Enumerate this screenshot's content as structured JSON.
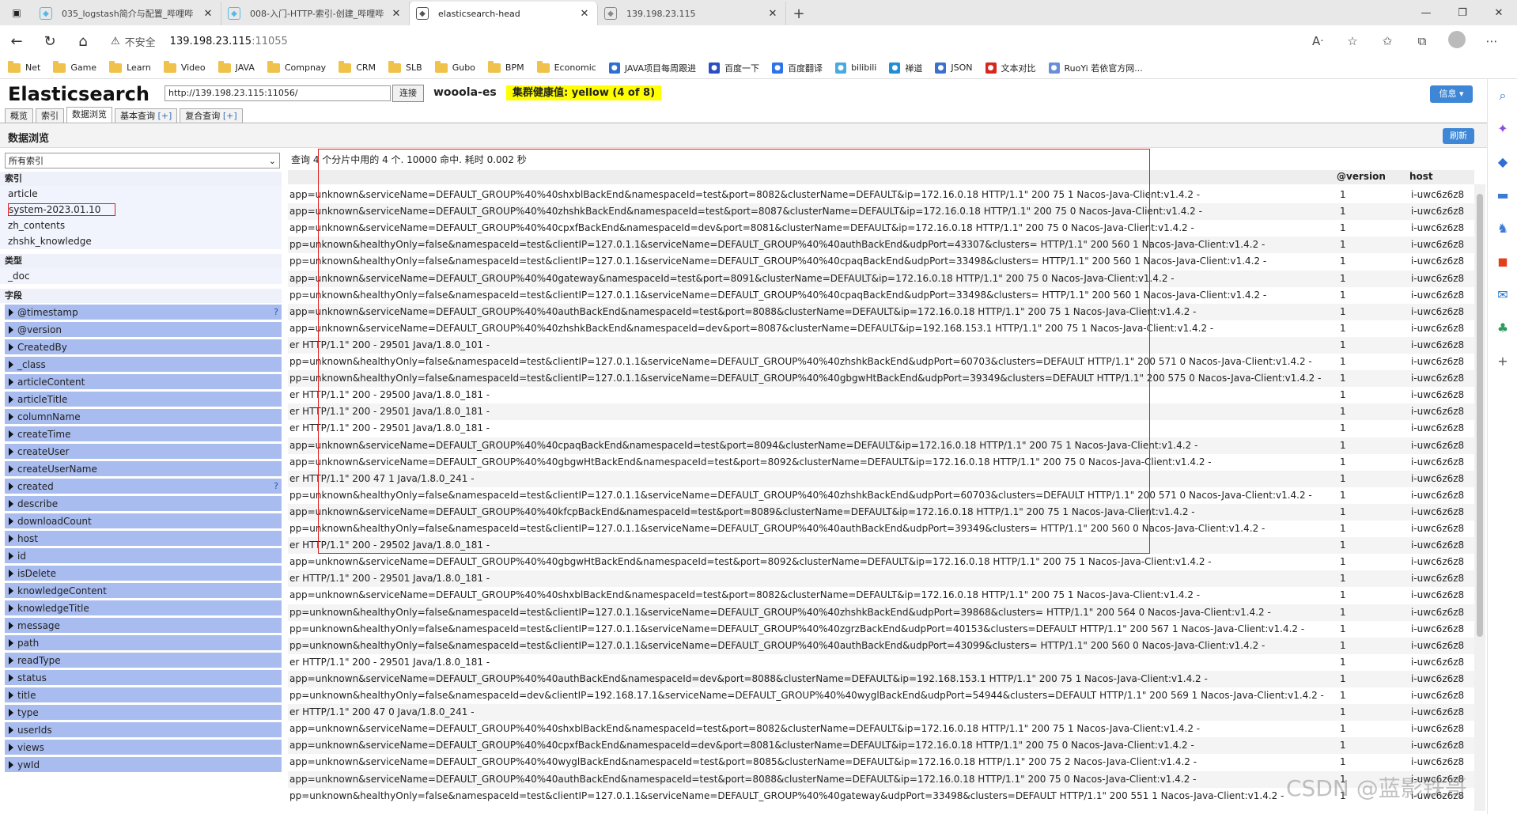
{
  "browser": {
    "tabs": [
      {
        "title": "035_logstash简介与配置_哔哩哔",
        "fav_color": "#59b8e6",
        "active": false
      },
      {
        "title": "008-入门-HTTP-索引-创建_哔哩哔",
        "fav_color": "#59b8e6",
        "active": false
      },
      {
        "title": "elasticsearch-head",
        "fav_color": "#555555",
        "active": true
      },
      {
        "title": "139.198.23.115",
        "fav_color": "#888888",
        "active": false
      }
    ],
    "address": {
      "insecure_label": "不安全",
      "host": "139.198.23.115",
      "port": ":11055"
    },
    "bookmarks": [
      {
        "label": "Net",
        "type": "folder"
      },
      {
        "label": "Game",
        "type": "folder"
      },
      {
        "label": "Learn",
        "type": "folder"
      },
      {
        "label": "Video",
        "type": "folder"
      },
      {
        "label": "JAVA",
        "type": "folder"
      },
      {
        "label": "Compnay",
        "type": "folder"
      },
      {
        "label": "CRM",
        "type": "folder"
      },
      {
        "label": "SLB",
        "type": "folder"
      },
      {
        "label": "Gubo",
        "type": "folder"
      },
      {
        "label": "BPM",
        "type": "folder"
      },
      {
        "label": "Economic",
        "type": "folder"
      },
      {
        "label": "JAVA项目每周跟进",
        "type": "icon",
        "color": "#2f6fd1"
      },
      {
        "label": "百度一下",
        "type": "icon",
        "color": "#2b4fbf"
      },
      {
        "label": "百度翻译",
        "type": "icon",
        "color": "#2e73e8"
      },
      {
        "label": "bilibili",
        "type": "icon",
        "color": "#49a9e0"
      },
      {
        "label": "禅道",
        "type": "icon",
        "color": "#1f8fd8"
      },
      {
        "label": "JSON",
        "type": "icon",
        "color": "#3b6fd1"
      },
      {
        "label": "文本对比",
        "type": "icon",
        "color": "#d7261e"
      },
      {
        "label": "RuoYi 若依官方网...",
        "type": "icon",
        "color": "#6a8fd8"
      }
    ]
  },
  "app": {
    "logo": "Elasticsearch",
    "cluster_url": "http://139.198.23.115:11056/",
    "connect_label": "连接",
    "cluster_name": "wooola-es",
    "health": "集群健康值: yellow (4 of 8)",
    "info_label": "信息 ▾",
    "tabs": [
      {
        "label": "概览",
        "plus": ""
      },
      {
        "label": "索引",
        "plus": ""
      },
      {
        "label": "数据浏览",
        "plus": ""
      },
      {
        "label": "基本查询 ",
        "plus": "[+]"
      },
      {
        "label": "复合查询 ",
        "plus": "[+]"
      }
    ],
    "section_title": "数据浏览",
    "refresh_label": "刷新"
  },
  "left": {
    "select_value": "所有索引",
    "index_header": "索引",
    "indices": [
      "article",
      "system-2023.01.10",
      "zh_contents",
      "zhshk_knowledge"
    ],
    "type_header": "类型",
    "types": [
      "_doc"
    ],
    "field_header": "字段",
    "fields": [
      {
        "name": "@timestamp",
        "q": "?"
      },
      {
        "name": "@version",
        "q": ""
      },
      {
        "name": "CreatedBy",
        "q": ""
      },
      {
        "name": "_class",
        "q": ""
      },
      {
        "name": "articleContent",
        "q": ""
      },
      {
        "name": "articleTitle",
        "q": ""
      },
      {
        "name": "columnName",
        "q": ""
      },
      {
        "name": "createTime",
        "q": ""
      },
      {
        "name": "createUser",
        "q": ""
      },
      {
        "name": "createUserName",
        "q": ""
      },
      {
        "name": "created",
        "q": "?"
      },
      {
        "name": "describe",
        "q": ""
      },
      {
        "name": "downloadCount",
        "q": ""
      },
      {
        "name": "host",
        "q": ""
      },
      {
        "name": "id",
        "q": ""
      },
      {
        "name": "isDelete",
        "q": ""
      },
      {
        "name": "knowledgeContent",
        "q": ""
      },
      {
        "name": "knowledgeTitle",
        "q": ""
      },
      {
        "name": "message",
        "q": ""
      },
      {
        "name": "path",
        "q": ""
      },
      {
        "name": "readType",
        "q": ""
      },
      {
        "name": "status",
        "q": ""
      },
      {
        "name": "title",
        "q": ""
      },
      {
        "name": "type",
        "q": ""
      },
      {
        "name": "userIds",
        "q": ""
      },
      {
        "name": "views",
        "q": ""
      },
      {
        "name": "ywId",
        "q": ""
      }
    ]
  },
  "results": {
    "meta": "查询 4 个分片中用的 4 个. 10000 命中. 耗时 0.002 秒",
    "columns": [
      "@version",
      "host"
    ],
    "rows": [
      {
        "msg": "app=unknown&serviceName=DEFAULT_GROUP%40%40shxblBackEnd&namespaceId=test&port=8082&clusterName=DEFAULT&ip=172.16.0.18 HTTP/1.1\" 200 75 1 Nacos-Java-Client:v1.4.2 -",
        "ver": "1",
        "host": "i-uwc6z6z8"
      },
      {
        "msg": "app=unknown&serviceName=DEFAULT_GROUP%40%40zhshkBackEnd&namespaceId=test&port=8087&clusterName=DEFAULT&ip=172.16.0.18 HTTP/1.1\" 200 75 0 Nacos-Java-Client:v1.4.2 -",
        "ver": "1",
        "host": "i-uwc6z6z8"
      },
      {
        "msg": "app=unknown&serviceName=DEFAULT_GROUP%40%40cpxfBackEnd&namespaceId=dev&port=8081&clusterName=DEFAULT&ip=172.16.0.18 HTTP/1.1\" 200 75 0 Nacos-Java-Client:v1.4.2 -",
        "ver": "1",
        "host": "i-uwc6z6z8"
      },
      {
        "msg": "pp=unknown&healthyOnly=false&namespaceId=test&clientIP=127.0.1.1&serviceName=DEFAULT_GROUP%40%40authBackEnd&udpPort=43307&clusters= HTTP/1.1\" 200 560 1 Nacos-Java-Client:v1.4.2 -",
        "ver": "1",
        "host": "i-uwc6z6z8"
      },
      {
        "msg": "pp=unknown&healthyOnly=false&namespaceId=test&clientIP=127.0.1.1&serviceName=DEFAULT_GROUP%40%40cpaqBackEnd&udpPort=33498&clusters= HTTP/1.1\" 200 560 1 Nacos-Java-Client:v1.4.2 -",
        "ver": "1",
        "host": "i-uwc6z6z8"
      },
      {
        "msg": "app=unknown&serviceName=DEFAULT_GROUP%40%40gateway&namespaceId=test&port=8091&clusterName=DEFAULT&ip=172.16.0.18 HTTP/1.1\" 200 75 0 Nacos-Java-Client:v1.4.2 -",
        "ver": "1",
        "host": "i-uwc6z6z8"
      },
      {
        "msg": "pp=unknown&healthyOnly=false&namespaceId=test&clientIP=127.0.1.1&serviceName=DEFAULT_GROUP%40%40cpaqBackEnd&udpPort=33498&clusters= HTTP/1.1\" 200 560 1 Nacos-Java-Client:v1.4.2 -",
        "ver": "1",
        "host": "i-uwc6z6z8"
      },
      {
        "msg": "app=unknown&serviceName=DEFAULT_GROUP%40%40authBackEnd&namespaceId=test&port=8088&clusterName=DEFAULT&ip=172.16.0.18 HTTP/1.1\" 200 75 1 Nacos-Java-Client:v1.4.2 -",
        "ver": "1",
        "host": "i-uwc6z6z8"
      },
      {
        "msg": "app=unknown&serviceName=DEFAULT_GROUP%40%40zhshkBackEnd&namespaceId=dev&port=8087&clusterName=DEFAULT&ip=192.168.153.1 HTTP/1.1\" 200 75 1 Nacos-Java-Client:v1.4.2 -",
        "ver": "1",
        "host": "i-uwc6z6z8"
      },
      {
        "msg": "er HTTP/1.1\" 200 - 29501 Java/1.8.0_101 -",
        "ver": "1",
        "host": "i-uwc6z6z8"
      },
      {
        "msg": "pp=unknown&healthyOnly=false&namespaceId=test&clientIP=127.0.1.1&serviceName=DEFAULT_GROUP%40%40zhshkBackEnd&udpPort=60703&clusters=DEFAULT HTTP/1.1\" 200 571 0 Nacos-Java-Client:v1.4.2 -",
        "ver": "1",
        "host": "i-uwc6z6z8"
      },
      {
        "msg": "pp=unknown&healthyOnly=false&namespaceId=test&clientIP=127.0.1.1&serviceName=DEFAULT_GROUP%40%40gbgwHtBackEnd&udpPort=39349&clusters=DEFAULT HTTP/1.1\" 200 575 0 Nacos-Java-Client:v1.4.2 -",
        "ver": "1",
        "host": "i-uwc6z6z8"
      },
      {
        "msg": "er HTTP/1.1\" 200 - 29500 Java/1.8.0_181 -",
        "ver": "1",
        "host": "i-uwc6z6z8"
      },
      {
        "msg": "er HTTP/1.1\" 200 - 29501 Java/1.8.0_181 -",
        "ver": "1",
        "host": "i-uwc6z6z8"
      },
      {
        "msg": "er HTTP/1.1\" 200 - 29501 Java/1.8.0_181 -",
        "ver": "1",
        "host": "i-uwc6z6z8"
      },
      {
        "msg": "app=unknown&serviceName=DEFAULT_GROUP%40%40cpaqBackEnd&namespaceId=test&port=8094&clusterName=DEFAULT&ip=172.16.0.18 HTTP/1.1\" 200 75 1 Nacos-Java-Client:v1.4.2 -",
        "ver": "1",
        "host": "i-uwc6z6z8"
      },
      {
        "msg": "app=unknown&serviceName=DEFAULT_GROUP%40%40gbgwHtBackEnd&namespaceId=test&port=8092&clusterName=DEFAULT&ip=172.16.0.18 HTTP/1.1\" 200 75 0 Nacos-Java-Client:v1.4.2 -",
        "ver": "1",
        "host": "i-uwc6z6z8"
      },
      {
        "msg": "er HTTP/1.1\" 200 47 1 Java/1.8.0_241 -",
        "ver": "1",
        "host": "i-uwc6z6z8"
      },
      {
        "msg": "pp=unknown&healthyOnly=false&namespaceId=test&clientIP=127.0.1.1&serviceName=DEFAULT_GROUP%40%40zhshkBackEnd&udpPort=60703&clusters=DEFAULT HTTP/1.1\" 200 571 0 Nacos-Java-Client:v1.4.2 -",
        "ver": "1",
        "host": "i-uwc6z6z8"
      },
      {
        "msg": "app=unknown&serviceName=DEFAULT_GROUP%40%40kfcpBackEnd&namespaceId=test&port=8089&clusterName=DEFAULT&ip=172.16.0.18 HTTP/1.1\" 200 75 1 Nacos-Java-Client:v1.4.2 -",
        "ver": "1",
        "host": "i-uwc6z6z8"
      },
      {
        "msg": "pp=unknown&healthyOnly=false&namespaceId=test&clientIP=127.0.1.1&serviceName=DEFAULT_GROUP%40%40authBackEnd&udpPort=39349&clusters= HTTP/1.1\" 200 560 0 Nacos-Java-Client:v1.4.2 -",
        "ver": "1",
        "host": "i-uwc6z6z8"
      },
      {
        "msg": "er HTTP/1.1\" 200 - 29502 Java/1.8.0_181 -",
        "ver": "1",
        "host": "i-uwc6z6z8"
      },
      {
        "msg": "app=unknown&serviceName=DEFAULT_GROUP%40%40gbgwHtBackEnd&namespaceId=test&port=8092&clusterName=DEFAULT&ip=172.16.0.18 HTTP/1.1\" 200 75 1 Nacos-Java-Client:v1.4.2 -",
        "ver": "1",
        "host": "i-uwc6z6z8"
      },
      {
        "msg": "er HTTP/1.1\" 200 - 29501 Java/1.8.0_181 -",
        "ver": "1",
        "host": "i-uwc6z6z8"
      },
      {
        "msg": "app=unknown&serviceName=DEFAULT_GROUP%40%40shxblBackEnd&namespaceId=test&port=8082&clusterName=DEFAULT&ip=172.16.0.18 HTTP/1.1\" 200 75 1 Nacos-Java-Client:v1.4.2 -",
        "ver": "1",
        "host": "i-uwc6z6z8"
      },
      {
        "msg": "pp=unknown&healthyOnly=false&namespaceId=test&clientIP=127.0.1.1&serviceName=DEFAULT_GROUP%40%40zhshkBackEnd&udpPort=39868&clusters= HTTP/1.1\" 200 564 0 Nacos-Java-Client:v1.4.2 -",
        "ver": "1",
        "host": "i-uwc6z6z8"
      },
      {
        "msg": "pp=unknown&healthyOnly=false&namespaceId=test&clientIP=127.0.1.1&serviceName=DEFAULT_GROUP%40%40zgrzBackEnd&udpPort=40153&clusters=DEFAULT HTTP/1.1\" 200 567 1 Nacos-Java-Client:v1.4.2 -",
        "ver": "1",
        "host": "i-uwc6z6z8"
      },
      {
        "msg": "pp=unknown&healthyOnly=false&namespaceId=test&clientIP=127.0.1.1&serviceName=DEFAULT_GROUP%40%40authBackEnd&udpPort=43099&clusters= HTTP/1.1\" 200 560 0 Nacos-Java-Client:v1.4.2 -",
        "ver": "1",
        "host": "i-uwc6z6z8"
      },
      {
        "msg": "er HTTP/1.1\" 200 - 29501 Java/1.8.0_181 -",
        "ver": "1",
        "host": "i-uwc6z6z8"
      },
      {
        "msg": "app=unknown&serviceName=DEFAULT_GROUP%40%40authBackEnd&namespaceId=dev&port=8088&clusterName=DEFAULT&ip=192.168.153.1 HTTP/1.1\" 200 75 1 Nacos-Java-Client:v1.4.2 -",
        "ver": "1",
        "host": "i-uwc6z6z8"
      },
      {
        "msg": "pp=unknown&healthyOnly=false&namespaceId=dev&clientIP=192.168.17.1&serviceName=DEFAULT_GROUP%40%40wyglBackEnd&udpPort=54944&clusters=DEFAULT HTTP/1.1\" 200 569 1 Nacos-Java-Client:v1.4.2 -",
        "ver": "1",
        "host": "i-uwc6z6z8"
      },
      {
        "msg": "er HTTP/1.1\" 200 47 0 Java/1.8.0_241 -",
        "ver": "1",
        "host": "i-uwc6z6z8"
      },
      {
        "msg": "app=unknown&serviceName=DEFAULT_GROUP%40%40shxblBackEnd&namespaceId=test&port=8082&clusterName=DEFAULT&ip=172.16.0.18 HTTP/1.1\" 200 75 1 Nacos-Java-Client:v1.4.2 -",
        "ver": "1",
        "host": "i-uwc6z6z8"
      },
      {
        "msg": "app=unknown&serviceName=DEFAULT_GROUP%40%40cpxfBackEnd&namespaceId=dev&port=8081&clusterName=DEFAULT&ip=172.16.0.18 HTTP/1.1\" 200 75 0 Nacos-Java-Client:v1.4.2 -",
        "ver": "1",
        "host": "i-uwc6z6z8"
      },
      {
        "msg": "app=unknown&serviceName=DEFAULT_GROUP%40%40wyglBackEnd&namespaceId=test&port=8085&clusterName=DEFAULT&ip=172.16.0.18 HTTP/1.1\" 200 75 2 Nacos-Java-Client:v1.4.2 -",
        "ver": "1",
        "host": "i-uwc6z6z8"
      },
      {
        "msg": "app=unknown&serviceName=DEFAULT_GROUP%40%40authBackEnd&namespaceId=test&port=8088&clusterName=DEFAULT&ip=172.16.0.18 HTTP/1.1\" 200 75 0 Nacos-Java-Client:v1.4.2 -",
        "ver": "1",
        "host": "i-uwc6z6z8"
      },
      {
        "msg": "pp=unknown&healthyOnly=false&namespaceId=test&clientIP=127.0.1.1&serviceName=DEFAULT_GROUP%40%40gateway&udpPort=33498&clusters=DEFAULT HTTP/1.1\" 200 551 1 Nacos-Java-Client:v1.4.2 -",
        "ver": "1",
        "host": "i-uwc6z6z8"
      }
    ]
  },
  "watermark": "CSDN @蓝影铁哥"
}
